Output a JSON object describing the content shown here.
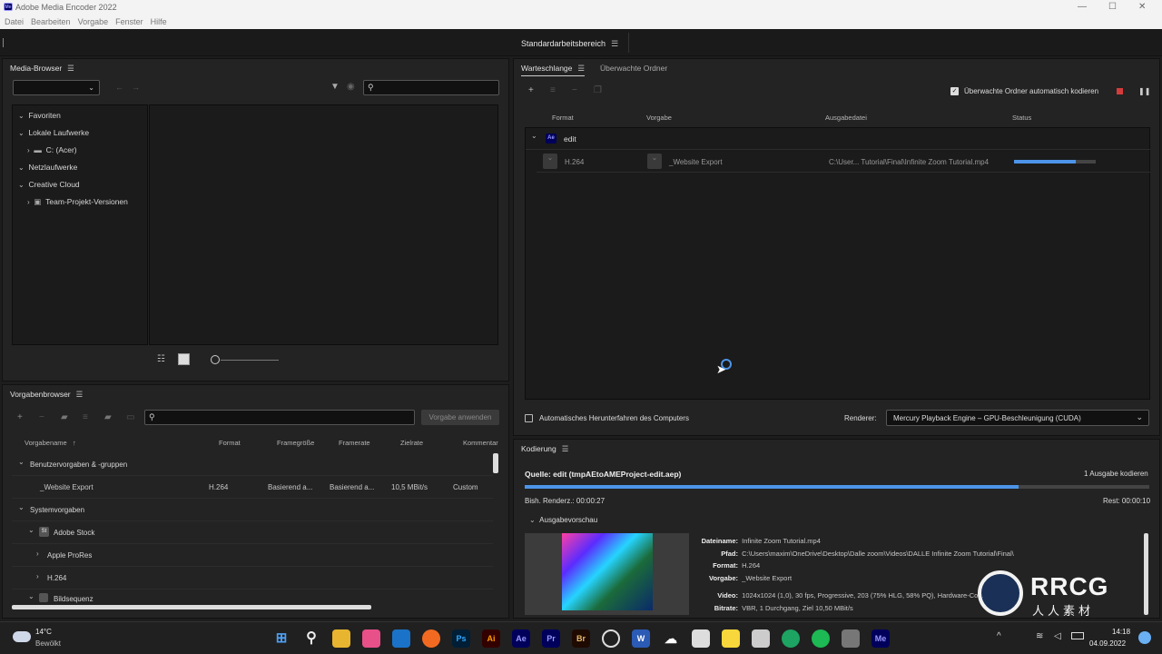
{
  "window": {
    "title": "Adobe Media Encoder 2022",
    "app_icon_label": "Me",
    "menu": [
      "Datei",
      "Bearbeiten",
      "Vorgabe",
      "Fenster",
      "Hilfe"
    ],
    "controls": {
      "minimize": "—",
      "maximize": "☐",
      "close": "✕"
    }
  },
  "workspace": {
    "label": "Standardarbeitsbereich"
  },
  "media_browser": {
    "title": "Media-Browser",
    "search_placeholder": "",
    "tree": [
      {
        "label": "Favoriten",
        "expanded": true,
        "level": 0
      },
      {
        "label": "Lokale Laufwerke",
        "expanded": true,
        "level": 0
      },
      {
        "label": "C: (Acer)",
        "expanded": false,
        "level": 1
      },
      {
        "label": "Netzlaufwerke",
        "expanded": true,
        "level": 0
      },
      {
        "label": "Creative Cloud",
        "expanded": true,
        "level": 0
      },
      {
        "label": "Team-Projekt-Versionen",
        "expanded": false,
        "level": 1
      }
    ]
  },
  "preset_browser": {
    "title": "Vorgabenbrowser",
    "apply_button": "Vorgabe anwenden",
    "columns": [
      "Vorgabename",
      "Format",
      "Framegröße",
      "Framerate",
      "Zielrate",
      "Kommentar"
    ],
    "groups": {
      "user": "Benutzervorgaben & -gruppen",
      "system": "Systemvorgaben",
      "adobe_stock": "Adobe Stock",
      "apple_prores": "Apple ProRes",
      "h264": "H.264",
      "image_sequence": "Bildsequenz"
    },
    "user_preset": {
      "name": "_Website Export",
      "format": "H.264",
      "frame_size": "Basierend a...",
      "frame_rate": "Basierend a...",
      "target_rate": "10,5 MBit/s",
      "comment": "Custom"
    }
  },
  "queue": {
    "tabs": [
      "Warteschlange",
      "Überwachte Ordner"
    ],
    "auto_encode_label": "Überwachte Ordner automatisch kodieren",
    "auto_encode_checked": true,
    "columns": [
      "Format",
      "Vorgabe",
      "Ausgabedatei",
      "Status"
    ],
    "item": {
      "name": "edit",
      "icon": "Ae",
      "format": "H.264",
      "preset": "_Website Export",
      "output": "C:\\User... Tutorial\\Final\\Infinite Zoom Tutorial.mp4",
      "progress": 0.75
    },
    "shutdown_label": "Automatisches Herunterfahren des Computers",
    "renderer_label": "Renderer:",
    "renderer_value": "Mercury Playback Engine – GPU-Beschleunigung (CUDA)"
  },
  "encoding": {
    "title": "Kodierung",
    "source": "Quelle: edit (tmpAEtoAMEProject-edit.aep)",
    "outputs": "1 Ausgabe kodieren",
    "progress": 0.79,
    "elapsed": "Bish. Renderz.: 00:00:27",
    "remaining": "Rest: 00:00:10",
    "preview_label": "Ausgabevorschau",
    "details": [
      {
        "k": "Dateiname:",
        "v": "Infinite Zoom Tutorial.mp4"
      },
      {
        "k": "Pfad:",
        "v": "C:\\Users\\maxim\\OneDrive\\Desktop\\Dalle zoom\\Videos\\DALLE Infinite Zoom Tutorial\\Final\\"
      },
      {
        "k": "Format:",
        "v": "H.264"
      },
      {
        "k": "Vorgabe:",
        "v": "_Website Export"
      },
      {
        "k": "Video:",
        "v": "1024x1024 (1,0), 30 fps, Progressive, 203 (75% HLG, 58% PQ), Hardware-Co..."
      },
      {
        "k": "Bitrate:",
        "v": "VBR, 1 Durchgang, Ziel 10,50 MBit/s"
      }
    ]
  },
  "watermark": {
    "logo": "RRCG",
    "sub": "人人素材"
  },
  "taskbar": {
    "weather_temp": "14°C",
    "weather_desc": "Bewölkt",
    "apps": [
      "Ps",
      "Ai",
      "Ae",
      "Pr",
      "Br",
      "W",
      "Me"
    ],
    "time": "14:18",
    "date": "04.09.2022"
  },
  "colors": {
    "accent": "#4d94e8",
    "panel": "#232323",
    "bg": "#1d1d1d"
  }
}
